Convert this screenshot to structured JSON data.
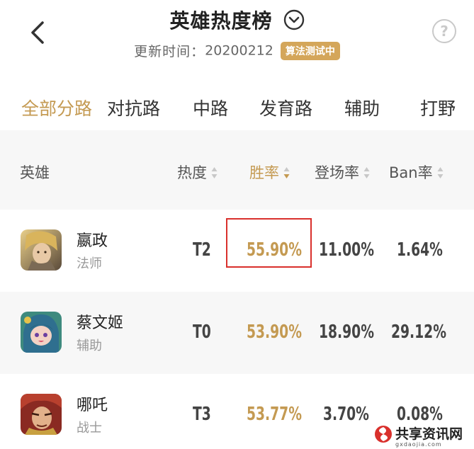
{
  "header": {
    "title": "英雄热度榜",
    "update_label": "更新时间：",
    "update_date": "20200212",
    "beta_badge": "算法测试中",
    "help_glyph": "?"
  },
  "tabs": [
    {
      "label": "全部分路",
      "active": true
    },
    {
      "label": "对抗路",
      "active": false
    },
    {
      "label": "中路",
      "active": false
    },
    {
      "label": "发育路",
      "active": false
    },
    {
      "label": "辅助",
      "active": false
    },
    {
      "label": "打野",
      "active": false
    }
  ],
  "table": {
    "columns": {
      "hero": "英雄",
      "heat": "热度",
      "win_rate": "胜率",
      "pick_rate": "登场率",
      "ban_rate": "Ban率"
    },
    "sorted_column": "win_rate",
    "sort_direction": "descending",
    "rows": [
      {
        "name": "嬴政",
        "role": "法师",
        "tier": "T2",
        "win_rate": "55.90%",
        "pick_rate": "11.00%",
        "ban_rate": "1.64%",
        "avatar_icon": "ying-zheng-avatar"
      },
      {
        "name": "蔡文姬",
        "role": "辅助",
        "tier": "T0",
        "win_rate": "53.90%",
        "pick_rate": "18.90%",
        "ban_rate": "29.12%",
        "avatar_icon": "cai-wenji-avatar"
      },
      {
        "name": "哪吒",
        "role": "战士",
        "tier": "T3",
        "win_rate": "53.77%",
        "pick_rate": "3.70%",
        "ban_rate": "0.08%",
        "avatar_icon": "nezha-avatar"
      }
    ]
  },
  "watermark": {
    "text": "共享资讯网",
    "url": "gxdaojia.com"
  },
  "colors": {
    "accent_gold": "#c49a52",
    "badge_gold": "#d4a65a",
    "highlight_red": "#d9302c"
  }
}
